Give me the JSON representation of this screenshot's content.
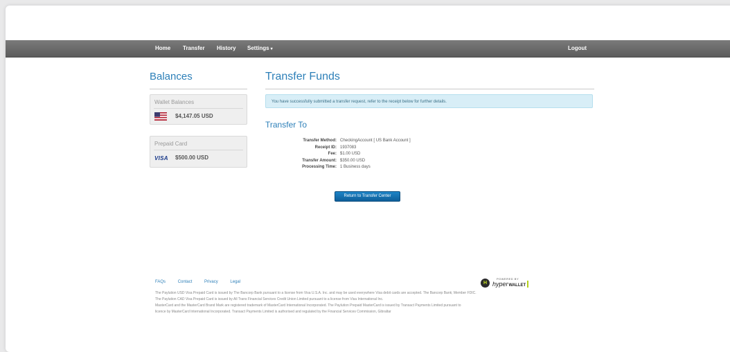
{
  "nav": {
    "home": "Home",
    "transfer": "Transfer",
    "history": "History",
    "settings": "Settings",
    "settings_caret": "▾",
    "logout": "Logout"
  },
  "sidebar": {
    "title": "Balances",
    "wallet_title": "Wallet Balances",
    "wallet_amount": "$4,147.05 USD",
    "wallet_icon": "us-flag-icon",
    "prepaid_title": "Prepaid Card",
    "prepaid_amount": "$500.00 USD",
    "prepaid_logo": "VISA"
  },
  "main": {
    "title": "Transfer Funds",
    "alert": "You have successfully submitted a transfer request, refer to the receipt below for further details.",
    "subtitle": "Transfer To",
    "details": [
      {
        "label": "Transfer Method:",
        "value": "CheckingAccount [ US Bank Account ]"
      },
      {
        "label": "Receipt ID:",
        "value": "1937083"
      },
      {
        "label": "Fee:",
        "value": "$1.00 USD"
      },
      {
        "label": "Transfer Amount:",
        "value": "$350.00 USD"
      },
      {
        "label": "Processing Time:",
        "value": "1 Business days"
      }
    ],
    "button": "Return to Transfer Center"
  },
  "footer": {
    "links": [
      "FAQs",
      "Contact",
      "Privacy",
      "Legal"
    ],
    "powered_by": "POWERED BY",
    "brand_hyper": "hyper",
    "brand_wallet": "WALLET",
    "badge": "H",
    "lines": [
      "The Paylution USD Visa Prepaid Card is issued by The Bancorp Bank pursuant to a license from Visa U.S.A. Inc. and may be used everywhere Visa debit cards are accepted. The Bancorp Bank; Member FDIC.",
      "The Paylution CAD Visa Prepaid Card is issued by All Trans Financial Services Credit Union Limited pursuant to a license from Visa International Inc.",
      "MasterCard and the MasterCard Brand Mark are registered trademark of MasterCard International Incorporated. The Paylution Prepaid MasterCard is issued by Transact Payments Limited pursuant to",
      "licence by MasterCard International Incorporated. Transact Payments Limited is authorised and regulated by the Financial Services Commission, Gibraltar"
    ]
  },
  "colors": {
    "accent": "#2c7fb8",
    "navbar": "#6a6a6a",
    "alert_bg": "#d8eef7",
    "button": "#1873b6"
  }
}
